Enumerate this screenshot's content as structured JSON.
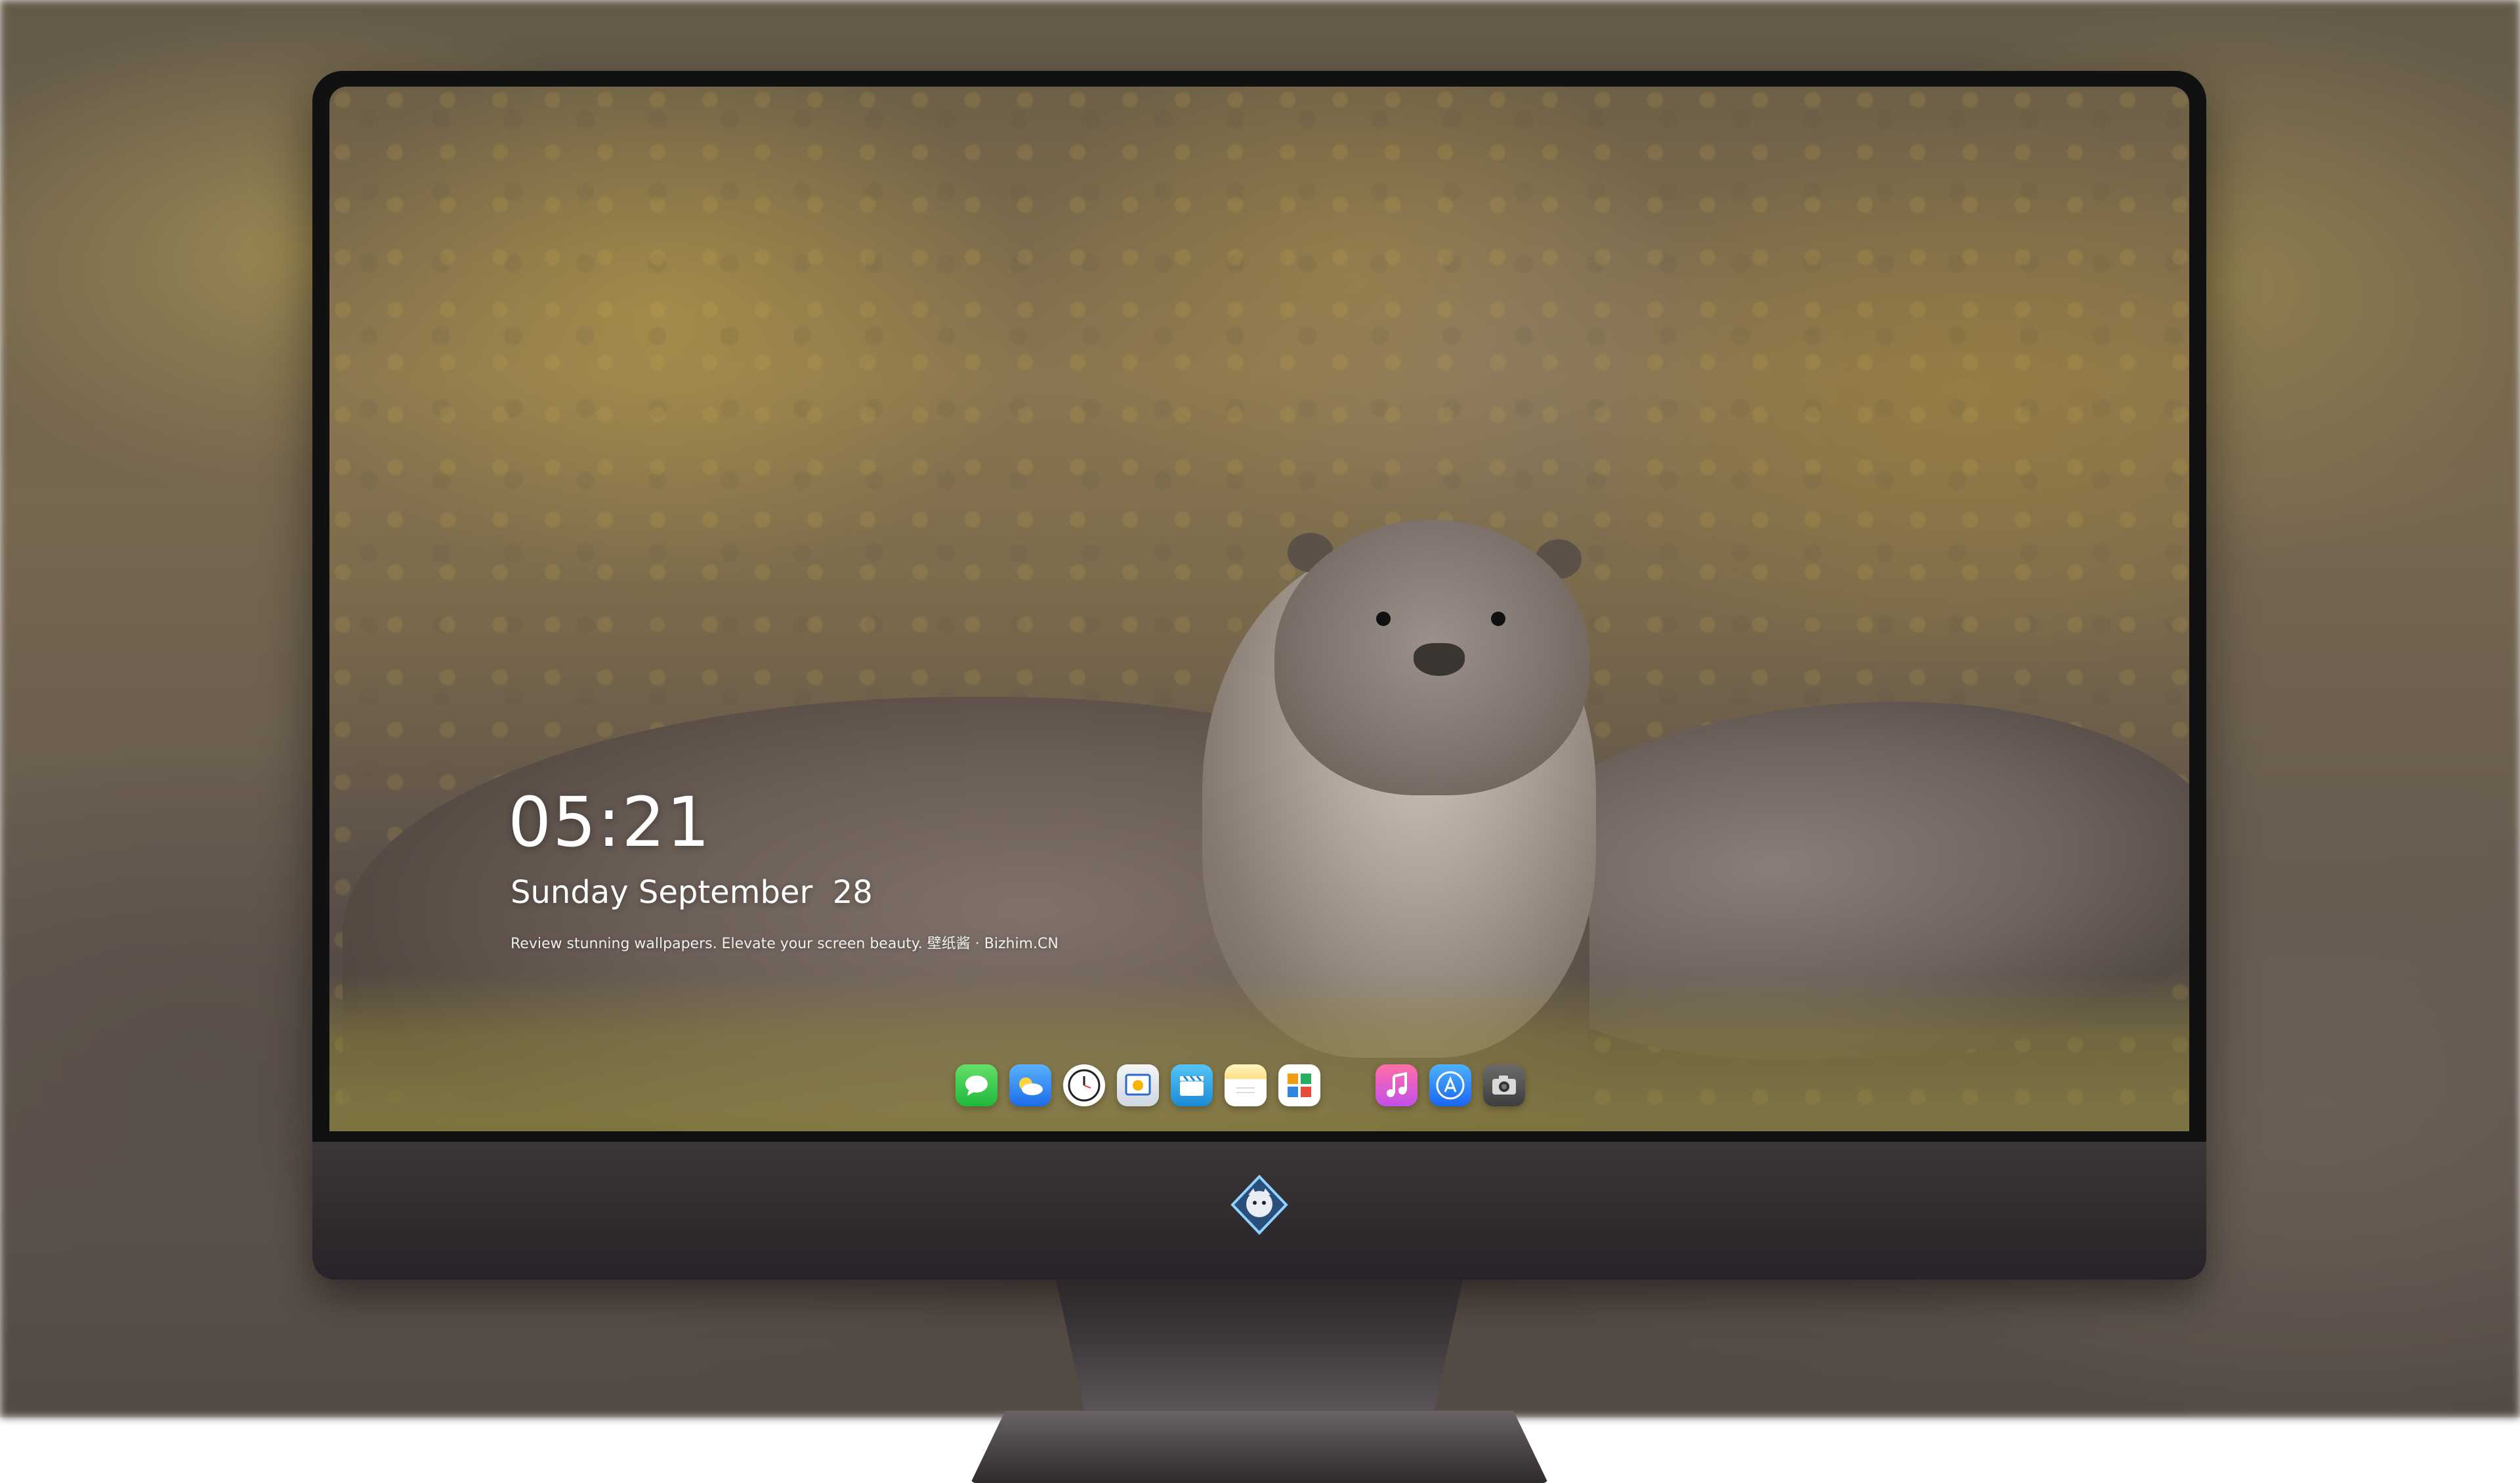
{
  "lock_screen": {
    "time": "05:21",
    "date": "Sunday September  28",
    "tagline": "Review stunning wallpapers. Elevate your screen beauty. 壁纸酱 · Bizhim.CN"
  },
  "dock": {
    "apps": [
      {
        "name": "Messages",
        "icon": "message-bubble-icon"
      },
      {
        "name": "Weather",
        "icon": "cloud-icon"
      },
      {
        "name": "Clock",
        "icon": "clock-icon"
      },
      {
        "name": "Preview",
        "icon": "preview-icon"
      },
      {
        "name": "Clips",
        "icon": "clapperboard-icon"
      },
      {
        "name": "Notes",
        "icon": "notes-icon"
      },
      {
        "name": "Photos",
        "icon": "photos-icon"
      },
      {
        "name": "Music",
        "icon": "music-note-icon"
      },
      {
        "name": "App Store",
        "icon": "app-store-icon"
      },
      {
        "name": "Camera",
        "icon": "camera-icon"
      }
    ]
  },
  "colors": {
    "bezel": "#111111",
    "chin": "#2f2a2c",
    "text": "#ffffff"
  }
}
